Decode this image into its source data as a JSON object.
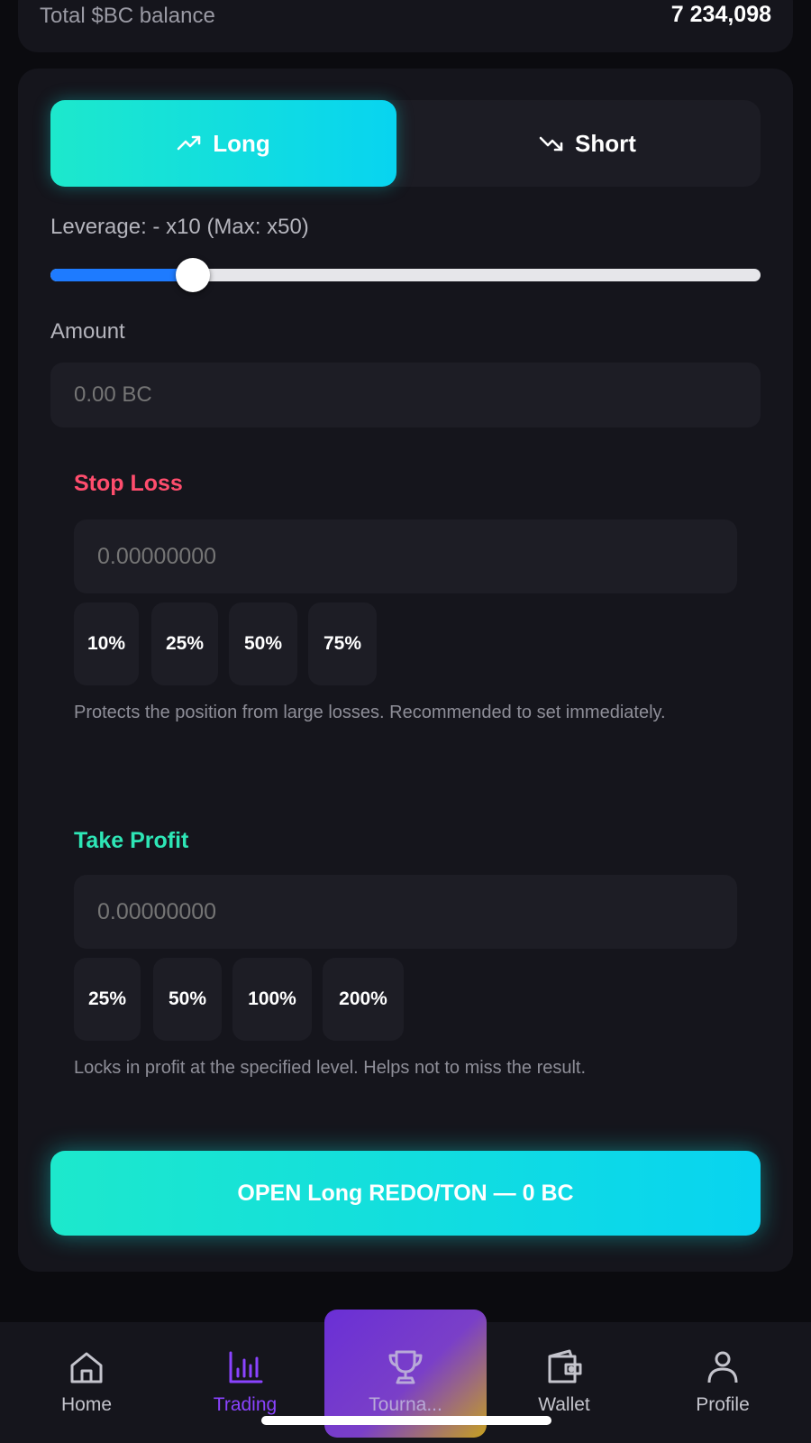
{
  "balance": {
    "label": "Total $BC balance",
    "value": "7 234,098"
  },
  "side_toggle": {
    "long_label": "Long",
    "short_label": "Short",
    "selected": "Long"
  },
  "leverage": {
    "label": "Leverage: - x10 (Max: x50)",
    "value": 10,
    "min": 1,
    "max": 50,
    "fill_fraction": 0.2
  },
  "amount": {
    "label": "Amount",
    "placeholder": "0.00 BC"
  },
  "stop_loss": {
    "title": "Stop Loss",
    "placeholder": "0.00000000",
    "chips": [
      "10%",
      "25%",
      "50%",
      "75%"
    ],
    "hint": "Protects the position from large losses. Recommended to set immediately."
  },
  "take_profit": {
    "title": "Take Profit",
    "placeholder": "0.00000000",
    "chips": [
      "25%",
      "50%",
      "100%",
      "200%"
    ],
    "hint": "Locks in profit at the specified level. Helps not to miss the result."
  },
  "open_button": {
    "label": "OPEN Long REDO/TON — 0 BC"
  },
  "nav": {
    "items": [
      {
        "label": "Home",
        "icon": "home-icon"
      },
      {
        "label": "Trading",
        "icon": "chart-bars-icon"
      },
      {
        "label": "Tourna...",
        "icon": "trophy-icon"
      },
      {
        "label": "Wallet",
        "icon": "wallet-icon"
      },
      {
        "label": "Profile",
        "icon": "user-icon"
      }
    ],
    "active": "Trading"
  },
  "colors": {
    "accent_gradient_start": "#1de8cc",
    "accent_gradient_end": "#08d4f0",
    "stop_loss": "#ff4d6d",
    "take_profit": "#2ee6b6",
    "active_nav": "#8a43ff",
    "slider_fill": "#1e7bff"
  }
}
